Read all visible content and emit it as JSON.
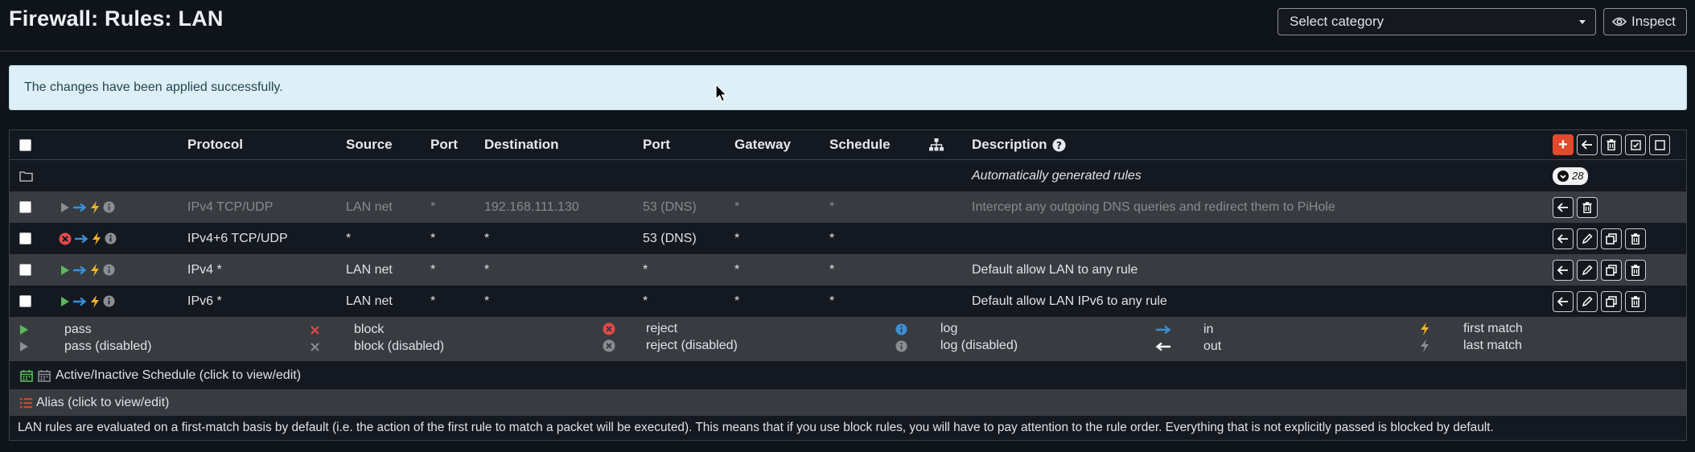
{
  "page": {
    "title": "Firewall: Rules: LAN",
    "category_placeholder": "Select category",
    "inspect_label": "Inspect"
  },
  "alert": {
    "message": "The changes have been applied successfully."
  },
  "table": {
    "headers": {
      "protocol": "Protocol",
      "source": "Source",
      "port": "Port",
      "destination": "Destination",
      "dest_port": "Port",
      "gateway": "Gateway",
      "schedule": "Schedule",
      "description": "Description"
    },
    "auto_group": {
      "label": "Automatically generated rules",
      "count": "28"
    },
    "rows": [
      {
        "state": "pass-disabled",
        "protocol": "IPv4 TCP/UDP",
        "source": "LAN net",
        "port": "*",
        "destination": "192.168.111.130",
        "dest_port": "53 (DNS)",
        "gateway": "*",
        "schedule": "*",
        "description": "Intercept any outgoing DNS queries and redirect them to PiHole"
      },
      {
        "state": "reject",
        "protocol": "IPv4+6 TCP/UDP",
        "source": "*",
        "port": "*",
        "destination": "*",
        "dest_port": "53 (DNS)",
        "gateway": "*",
        "schedule": "*",
        "description": ""
      },
      {
        "state": "pass",
        "protocol": "IPv4 *",
        "source": "LAN net",
        "port": "*",
        "destination": "*",
        "dest_port": "*",
        "gateway": "*",
        "schedule": "*",
        "description": "Default allow LAN to any rule"
      },
      {
        "state": "pass",
        "protocol": "IPv6 *",
        "source": "LAN net",
        "port": "*",
        "destination": "*",
        "dest_port": "*",
        "gateway": "*",
        "schedule": "*",
        "description": "Default allow LAN IPv6 to any rule"
      }
    ]
  },
  "legend": {
    "pass": "pass",
    "pass_disabled": "pass (disabled)",
    "block": "block",
    "block_disabled": "block (disabled)",
    "reject": "reject",
    "reject_disabled": "reject (disabled)",
    "log": "log",
    "log_disabled": "log (disabled)",
    "in": "in",
    "out": "out",
    "first_match": "first match",
    "last_match": "last match"
  },
  "footer": {
    "schedule_note": "Active/Inactive Schedule (click to view/edit)",
    "alias_note": "Alias (click to view/edit)",
    "info": "LAN rules are evaluated on a first-match basis by default (i.e. the action of the first rule to match a packet will be executed). This means that if you use block rules, you will have to pay attention to the rule order. Everything that is not explicitly passed is blocked by default."
  },
  "colors": {
    "pass": "#5cb85c",
    "reject": "#e24b4b",
    "in_arrow": "#3b8fd6",
    "first_match": "#f0b429",
    "add_button": "#e2492d"
  }
}
